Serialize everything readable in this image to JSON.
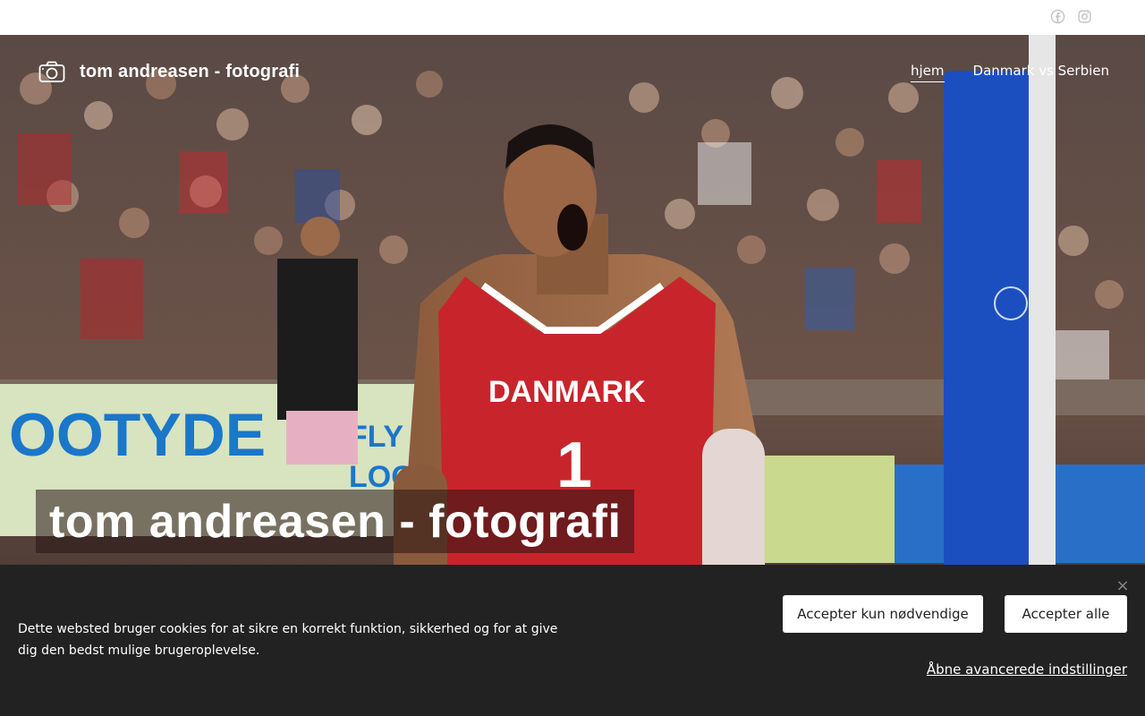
{
  "header": {
    "social": [
      {
        "name": "facebook-icon",
        "color": "#c4c4c4"
      },
      {
        "name": "instagram-icon",
        "color": "#c4c4c4"
      }
    ]
  },
  "hero": {
    "brand_name": "tom andreasen - fotografi",
    "brand_icon": "camera-icon",
    "nav": [
      {
        "label": "hjem",
        "active": true
      },
      {
        "label": "Danmark vs Serbien",
        "active": false
      }
    ],
    "title": "tom andreasen - fotografi",
    "photo": {
      "jersey_text": "DANMARK",
      "jersey_number": "1",
      "board_text_left": "OOTYDE",
      "board_text_mid": "FLY",
      "board_text_mid2": "LOC"
    }
  },
  "cookie_banner": {
    "text": "Dette websted bruger cookies for at sikre en korrekt funktion, sikkerhed og for at give dig den bedst mulige brugeroplevelse.",
    "accept_necessary": "Accepter kun nødvendige",
    "accept_all": "Accepter alle",
    "advanced_link": "Åbne avancerede indstillinger",
    "close_symbol": "×"
  }
}
